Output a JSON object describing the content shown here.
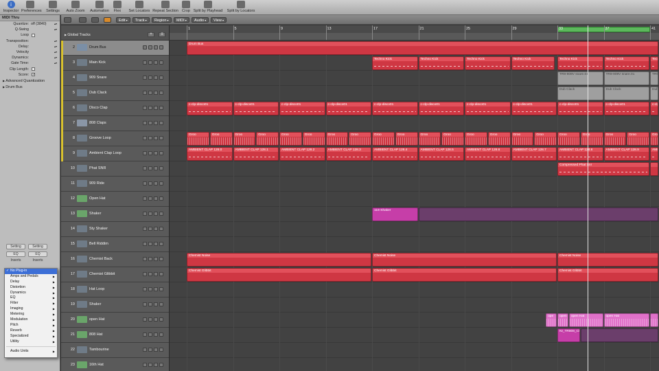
{
  "toolbar": {
    "left": [
      {
        "label": "Inspector",
        "icon": "info-icon"
      },
      {
        "label": "Preferences",
        "icon": "switch-icon"
      },
      {
        "label": "Settings",
        "icon": "settings-icon"
      }
    ],
    "right": [
      {
        "label": "Auto Zoom",
        "icon": "zoom-icon"
      },
      {
        "label": "Automation",
        "icon": "automation-icon"
      },
      {
        "label": "Flex",
        "icon": "flex-icon"
      },
      {
        "label": "Set Locators",
        "icon": "locators-icon"
      },
      {
        "label": "Repeat Section",
        "icon": "repeat-icon"
      },
      {
        "label": "Crop",
        "icon": "crop-icon"
      },
      {
        "label": "Split by Playhead",
        "icon": "split-playhead-icon"
      },
      {
        "label": "Split by Locators",
        "icon": "split-locators-icon"
      }
    ]
  },
  "inspector": {
    "header": "MIDI Thru",
    "rows": [
      {
        "key": "Quantize:",
        "value": "off (3840)"
      },
      {
        "key": "Q-Swing",
        "value": ""
      },
      {
        "key": "Loop",
        "value": "",
        "check": false
      },
      {
        "key": "Transposition:",
        "value": ""
      },
      {
        "key": "Delay:",
        "value": ""
      },
      {
        "key": "Velocity",
        "value": ""
      },
      {
        "key": "Dynamics:",
        "value": ""
      },
      {
        "key": "Gate Time:",
        "value": ""
      },
      {
        "key": "Clip Length:",
        "value": "",
        "check": false
      },
      {
        "key": "Score:",
        "value": "",
        "check": true
      }
    ],
    "advanced": "Advanced Quantization",
    "section": "Drum Bus",
    "strip": {
      "setting": "Setting",
      "eq": "EQ",
      "inserts": "Inserts"
    }
  },
  "plugin_menu": {
    "items": [
      {
        "label": "No Plug-in",
        "selected": true
      },
      {
        "label": "Amps and Pedals",
        "sub": true
      },
      {
        "label": "Delay",
        "sub": true
      },
      {
        "label": "Distortion",
        "sub": true
      },
      {
        "label": "Dynamics",
        "sub": true
      },
      {
        "label": "EQ",
        "sub": true
      },
      {
        "label": "Filter",
        "sub": true
      },
      {
        "label": "Imaging",
        "sub": true
      },
      {
        "label": "Metering",
        "sub": true
      },
      {
        "label": "Modulation",
        "sub": true
      },
      {
        "label": "Pitch",
        "sub": true
      },
      {
        "label": "Reverb",
        "sub": true
      },
      {
        "label": "Specialized",
        "sub": true
      },
      {
        "label": "Utility",
        "sub": true
      }
    ],
    "footer": {
      "label": "Audio Units",
      "sub": true
    }
  },
  "local_menu": [
    "Edit",
    "Track",
    "Region",
    "MIDI",
    "Audio",
    "View"
  ],
  "global_tracks": "Global Tracks",
  "ruler": {
    "bars": [
      "1",
      "5",
      "9",
      "13",
      "17",
      "21",
      "25",
      "29",
      "33",
      "37",
      "41"
    ]
  },
  "tracks": [
    {
      "num": "2",
      "name": "Drum Bus",
      "color": "#d8c12e",
      "type": "bus",
      "selected": true
    },
    {
      "num": "3",
      "name": "Main Kick",
      "color": "#d8c12e",
      "type": "audio"
    },
    {
      "num": "4",
      "name": "909 Snare",
      "color": "#d8c12e",
      "type": "audio"
    },
    {
      "num": "5",
      "name": "Dub Clack",
      "color": "#d8c12e",
      "type": "audio"
    },
    {
      "num": "6",
      "name": "Disco Clap",
      "color": "#d8c12e",
      "type": "audio"
    },
    {
      "num": "7",
      "name": "808 Claps",
      "color": "#d8c12e",
      "type": "synth"
    },
    {
      "num": "8",
      "name": "Groove Loop",
      "color": "#d8c12e",
      "type": "audio"
    },
    {
      "num": "9",
      "name": "Ambient Clap Loop",
      "color": "#d8c12e",
      "type": "audio"
    },
    {
      "num": "10",
      "name": "Phat SNR",
      "color": "",
      "type": "audio"
    },
    {
      "num": "11",
      "name": "909 Ride",
      "color": "",
      "type": "audio"
    },
    {
      "num": "12",
      "name": "Open Hat",
      "color": "",
      "type": "green"
    },
    {
      "num": "13",
      "name": "Shaker",
      "color": "",
      "type": "green"
    },
    {
      "num": "14",
      "name": "Sty Shaker",
      "color": "",
      "type": "audio"
    },
    {
      "num": "15",
      "name": "Bell Riddim",
      "color": "",
      "type": "audio"
    },
    {
      "num": "16",
      "name": "Chemist Back",
      "color": "",
      "type": "audio"
    },
    {
      "num": "17",
      "name": "Chemist Glibbit",
      "color": "",
      "type": "audio"
    },
    {
      "num": "18",
      "name": "Hat Loop",
      "color": "",
      "type": "audio"
    },
    {
      "num": "19",
      "name": "Shaker",
      "color": "",
      "type": "audio"
    },
    {
      "num": "20",
      "name": "open Hat",
      "color": "",
      "type": "green"
    },
    {
      "num": "21",
      "name": "808 Hat",
      "color": "",
      "type": "green"
    },
    {
      "num": "22",
      "name": "Tambourine",
      "color": "",
      "type": "audio"
    },
    {
      "num": "23",
      "name": "16th Hat",
      "color": "",
      "type": "green"
    }
  ],
  "regions": [
    {
      "row": 0,
      "bar_start": 1,
      "bar_end": 45,
      "name": "Drum Bus",
      "style": "red"
    },
    {
      "row": 1,
      "bar_start": 17,
      "bar_end": 21,
      "name": "Techno Kick",
      "style": "red midi"
    },
    {
      "row": 1,
      "bar_start": 21,
      "bar_end": 25,
      "name": "Techno Kick",
      "style": "red midi"
    },
    {
      "row": 1,
      "bar_start": 25,
      "bar_end": 29,
      "name": "Techno Kick",
      "style": "red midi"
    },
    {
      "row": 1,
      "bar_start": 29,
      "bar_end": 32.8,
      "name": "Techno Kick",
      "style": "red midi"
    },
    {
      "row": 1,
      "bar_start": 33,
      "bar_end": 37,
      "name": "Techno Kick",
      "style": "red midi"
    },
    {
      "row": 1,
      "bar_start": 37,
      "bar_end": 41,
      "name": "Techno Kick",
      "style": "red midi"
    },
    {
      "row": 1,
      "bar_start": 41,
      "bar_end": 45,
      "name": "Techno Kick",
      "style": "red midi"
    },
    {
      "row": 2,
      "bar_start": 33,
      "bar_end": 37,
      "name": "TR9-909V snare.01",
      "style": "gray"
    },
    {
      "row": 2,
      "bar_start": 37,
      "bar_end": 41,
      "name": "TR9-909V snare.01",
      "style": "gray"
    },
    {
      "row": 2,
      "bar_start": 41,
      "bar_end": 45,
      "name": "TR9-909V",
      "style": "gray"
    },
    {
      "row": 3,
      "bar_start": 33,
      "bar_end": 37,
      "name": "Dub Clack",
      "style": "gray"
    },
    {
      "row": 3,
      "bar_start": 37,
      "bar_end": 41,
      "name": "Dub Clack",
      "style": "gray"
    },
    {
      "row": 3,
      "bar_start": 41,
      "bar_end": 45,
      "name": "Dub Clack",
      "style": "gray"
    },
    {
      "row": 4,
      "bar_start": 1,
      "bar_end": 5,
      "name": "c-clp-disco01",
      "style": "red midi"
    },
    {
      "row": 4,
      "bar_start": 5,
      "bar_end": 9,
      "name": "c-clp-disco01",
      "style": "red midi"
    },
    {
      "row": 4,
      "bar_start": 9,
      "bar_end": 13,
      "name": "c-clp-disco01",
      "style": "red midi"
    },
    {
      "row": 4,
      "bar_start": 13,
      "bar_end": 17,
      "name": "c-clp-disco01",
      "style": "red midi"
    },
    {
      "row": 4,
      "bar_start": 17,
      "bar_end": 21,
      "name": "c-clp-disco01",
      "style": "red midi"
    },
    {
      "row": 4,
      "bar_start": 21,
      "bar_end": 25,
      "name": "c-clp-disco01",
      "style": "red midi"
    },
    {
      "row": 4,
      "bar_start": 25,
      "bar_end": 29,
      "name": "c-clp-disco01",
      "style": "red midi"
    },
    {
      "row": 4,
      "bar_start": 29,
      "bar_end": 33,
      "name": "c-clp-disco01",
      "style": "red midi"
    },
    {
      "row": 4,
      "bar_start": 33,
      "bar_end": 37,
      "name": "c-clp-disco01",
      "style": "red midi"
    },
    {
      "row": 4,
      "bar_start": 37,
      "bar_end": 41,
      "name": "c-clp-disco01",
      "style": "red midi"
    },
    {
      "row": 4,
      "bar_start": 41,
      "bar_end": 45,
      "name": "c-clp-disco01",
      "style": "red midi"
    },
    {
      "row": 6,
      "bar_start": 1,
      "bar_end": 3,
      "name": "Groo",
      "style": "red wave"
    },
    {
      "row": 6,
      "bar_start": 3,
      "bar_end": 5,
      "name": "Groo",
      "style": "red wave"
    },
    {
      "row": 6,
      "bar_start": 5,
      "bar_end": 7,
      "name": "Groo",
      "style": "red wave"
    },
    {
      "row": 6,
      "bar_start": 7,
      "bar_end": 9,
      "name": "Groo",
      "style": "red wave"
    },
    {
      "row": 6,
      "bar_start": 9,
      "bar_end": 11,
      "name": "Groo",
      "style": "red wave"
    },
    {
      "row": 6,
      "bar_start": 11,
      "bar_end": 13,
      "name": "Groo",
      "style": "red wave"
    },
    {
      "row": 6,
      "bar_start": 13,
      "bar_end": 15,
      "name": "Groo",
      "style": "red wave"
    },
    {
      "row": 6,
      "bar_start": 15,
      "bar_end": 17,
      "name": "Groo",
      "style": "red wave"
    },
    {
      "row": 6,
      "bar_start": 17,
      "bar_end": 19,
      "name": "Groo",
      "style": "red wave"
    },
    {
      "row": 6,
      "bar_start": 19,
      "bar_end": 21,
      "name": "Groo",
      "style": "red wave"
    },
    {
      "row": 6,
      "bar_start": 21,
      "bar_end": 23,
      "name": "Groo",
      "style": "red wave"
    },
    {
      "row": 6,
      "bar_start": 23,
      "bar_end": 25,
      "name": "Groo",
      "style": "red wave"
    },
    {
      "row": 6,
      "bar_start": 25,
      "bar_end": 27,
      "name": "Groo",
      "style": "red wave"
    },
    {
      "row": 6,
      "bar_start": 27,
      "bar_end": 29,
      "name": "Groo",
      "style": "red wave"
    },
    {
      "row": 6,
      "bar_start": 29,
      "bar_end": 31,
      "name": "Groo",
      "style": "red wave"
    },
    {
      "row": 6,
      "bar_start": 31,
      "bar_end": 33,
      "name": "Groo",
      "style": "red wave"
    },
    {
      "row": 6,
      "bar_start": 33,
      "bar_end": 35,
      "name": "Groo",
      "style": "red wave"
    },
    {
      "row": 6,
      "bar_start": 35,
      "bar_end": 37,
      "name": "Groo",
      "style": "red wave"
    },
    {
      "row": 6,
      "bar_start": 37,
      "bar_end": 39,
      "name": "Groo",
      "style": "red wave"
    },
    {
      "row": 6,
      "bar_start": 39,
      "bar_end": 41,
      "name": "Groo",
      "style": "red wave"
    },
    {
      "row": 6,
      "bar_start": 41,
      "bar_end": 43,
      "name": "Groo",
      "style": "red wave"
    },
    {
      "row": 6,
      "bar_start": 43,
      "bar_end": 45,
      "name": "Groo",
      "style": "red wave"
    },
    {
      "row": 7,
      "bar_start": 1,
      "bar_end": 5,
      "name": "AMBIENT CLAP 128.0",
      "style": "red midi"
    },
    {
      "row": 7,
      "bar_start": 5,
      "bar_end": 9,
      "name": "AMBIENT CLAP 128.1",
      "style": "red midi"
    },
    {
      "row": 7,
      "bar_start": 9,
      "bar_end": 13,
      "name": "AMBIENT CLAP 128.2",
      "style": "red midi"
    },
    {
      "row": 7,
      "bar_start": 13,
      "bar_end": 17,
      "name": "AMBIENT CLAP 128.3",
      "style": "red midi"
    },
    {
      "row": 7,
      "bar_start": 17,
      "bar_end": 21,
      "name": "AMBIENT CLAP 128.4",
      "style": "red midi"
    },
    {
      "row": 7,
      "bar_start": 21,
      "bar_end": 25,
      "name": "AMBIENT CLAP 128.5",
      "style": "red midi"
    },
    {
      "row": 7,
      "bar_start": 25,
      "bar_end": 29,
      "name": "AMBIENT CLAP 128.6",
      "style": "red midi"
    },
    {
      "row": 7,
      "bar_start": 29,
      "bar_end": 33,
      "name": "AMBIENT CLAP 128.7",
      "style": "red midi"
    },
    {
      "row": 7,
      "bar_start": 33,
      "bar_end": 37,
      "name": "AMBIENT CLAP 128.8",
      "style": "red midi"
    },
    {
      "row": 7,
      "bar_start": 37,
      "bar_end": 41,
      "name": "AMBIENT CLAP 128.9",
      "style": "red midi"
    },
    {
      "row": 7,
      "bar_start": 41,
      "bar_end": 45,
      "name": "AMBIENT CLA",
      "style": "red midi"
    },
    {
      "row": 8,
      "bar_start": 33,
      "bar_end": 41,
      "name": "Compressed Phat Snr",
      "style": "red midi"
    },
    {
      "row": 8,
      "bar_start": 41,
      "bar_end": 45,
      "name": "",
      "style": "red"
    },
    {
      "row": 11,
      "bar_start": 17,
      "bar_end": 21,
      "name": "116-Shaker",
      "style": "magenta"
    },
    {
      "row": 11,
      "bar_start": 21,
      "bar_end": 45,
      "name": "",
      "style": "dim"
    },
    {
      "row": 14,
      "bar_start": 1,
      "bar_end": 17,
      "name": "Chemist Noise",
      "style": "red"
    },
    {
      "row": 14,
      "bar_start": 17,
      "bar_end": 33,
      "name": "Chemist Noise",
      "style": "red"
    },
    {
      "row": 14,
      "bar_start": 33,
      "bar_end": 45,
      "name": "Chemist Noise",
      "style": "red"
    },
    {
      "row": 15,
      "bar_start": 1,
      "bar_end": 17,
      "name": "Chemist Glibbit",
      "style": "red"
    },
    {
      "row": 15,
      "bar_start": 17,
      "bar_end": 33,
      "name": "Chemist Glibbit",
      "style": "red"
    },
    {
      "row": 15,
      "bar_start": 33,
      "bar_end": 45,
      "name": "Chemist Glibbit",
      "style": "red"
    },
    {
      "row": 18,
      "bar_start": 32,
      "bar_end": 33,
      "name": "ope",
      "style": "pink wave"
    },
    {
      "row": 18,
      "bar_start": 33,
      "bar_end": 34,
      "name": "open",
      "style": "pink wave"
    },
    {
      "row": 18,
      "bar_start": 34,
      "bar_end": 37,
      "name": "open Hat",
      "style": "pink wave"
    },
    {
      "row": 18,
      "bar_start": 37,
      "bar_end": 41,
      "name": "open Hat",
      "style": "pink wave"
    },
    {
      "row": 18,
      "bar_start": 41,
      "bar_end": 45,
      "name": "",
      "style": "pink wave"
    },
    {
      "row": 19,
      "bar_start": 33,
      "bar_end": 35,
      "name": "NI_TR808_ClHat1",
      "style": "magenta"
    },
    {
      "row": 19,
      "bar_start": 35,
      "bar_end": 45,
      "name": "",
      "style": "dim"
    }
  ],
  "cycle": {
    "bar_start": 33,
    "bar_end": 41
  },
  "playhead_bar": 35.6
}
